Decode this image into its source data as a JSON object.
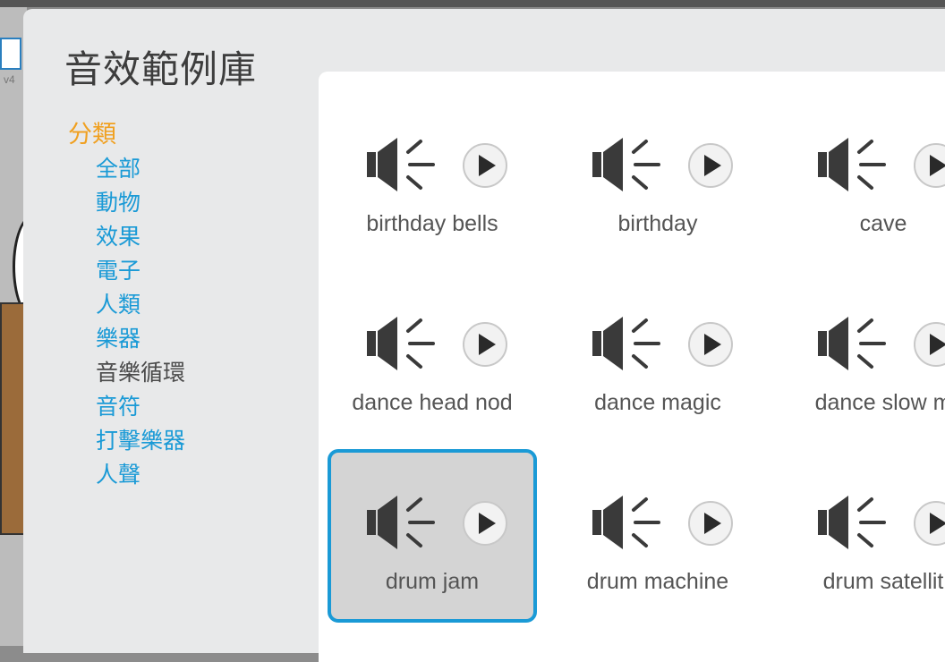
{
  "dialog": {
    "title": "音效範例庫"
  },
  "background": {
    "version_label": "v4"
  },
  "categories": {
    "heading": "分類",
    "items": [
      {
        "label": "全部",
        "active": false
      },
      {
        "label": "動物",
        "active": false
      },
      {
        "label": "效果",
        "active": false
      },
      {
        "label": "電子",
        "active": false
      },
      {
        "label": "人類",
        "active": false
      },
      {
        "label": "樂器",
        "active": false
      },
      {
        "label": "音樂循環",
        "active": true
      },
      {
        "label": "音符",
        "active": false
      },
      {
        "label": "打擊樂器",
        "active": false
      },
      {
        "label": "人聲",
        "active": false
      }
    ]
  },
  "sounds": [
    {
      "name": "birthday bells",
      "selected": false,
      "icon": "speaker-icon"
    },
    {
      "name": "birthday",
      "selected": false,
      "icon": "speaker-icon"
    },
    {
      "name": "cave",
      "selected": false,
      "icon": "speaker-icon"
    },
    {
      "name": "dance head nod",
      "selected": false,
      "icon": "speaker-icon"
    },
    {
      "name": "dance magic",
      "selected": false,
      "icon": "speaker-icon"
    },
    {
      "name": "dance slow m",
      "selected": false,
      "icon": "speaker-icon"
    },
    {
      "name": "drum jam",
      "selected": true,
      "icon": "speaker-icon"
    },
    {
      "name": "drum machine",
      "selected": false,
      "icon": "speaker-icon"
    },
    {
      "name": "drum satellit",
      "selected": false,
      "icon": "speaker-icon"
    }
  ],
  "colors": {
    "accent": "#1a9ad6",
    "category_heading": "#f0a020",
    "active_category": "#4a4a4a"
  }
}
